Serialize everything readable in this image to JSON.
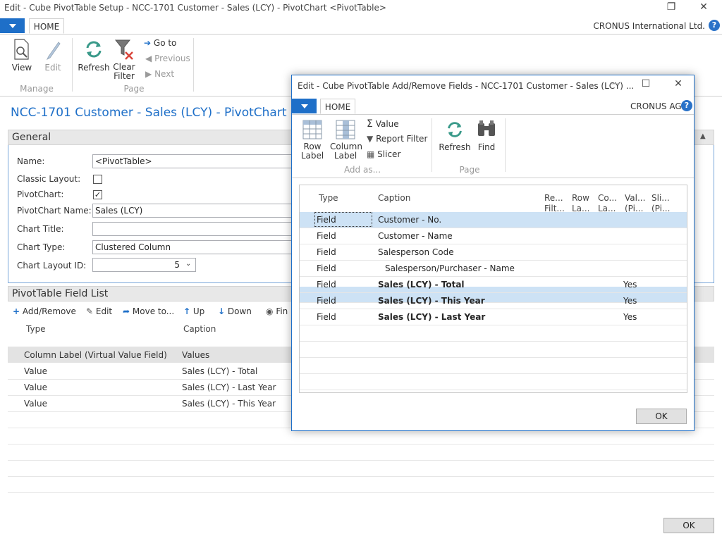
{
  "window": {
    "title": "Edit - Cube PivotTable Setup - NCC-1701 Customer - Sales (LCY) - PivotChart <PivotTable>",
    "company": "CRONUS International Ltd."
  },
  "ribbon": {
    "tab": "HOME",
    "view": "View",
    "edit": "Edit",
    "manage_group": "Manage",
    "refresh": "Refresh",
    "clear": "Clear",
    "filter": "Filter",
    "go_to": "Go to",
    "previous": "Previous",
    "next": "Next",
    "page_group": "Page"
  },
  "page": {
    "title": "NCC-1701 Customer - Sales (LCY) - PivotChart <Piv"
  },
  "general": {
    "header": "General",
    "name_label": "Name:",
    "name_value": "<PivotTable>",
    "classic_layout_label": "Classic Layout:",
    "pivotchart_label": "PivotChart:",
    "pivotchart_name_label": "PivotChart Name:",
    "pivotchart_name_value": "Sales (LCY)",
    "chart_title_label": "Chart Title:",
    "chart_title_value": "",
    "chart_type_label": "Chart Type:",
    "chart_type_value": "Clustered Column",
    "chart_layout_label": "Chart Layout ID:",
    "chart_layout_value": "5"
  },
  "field_list": {
    "header": "PivotTable Field List",
    "actions": {
      "add_remove": "Add/Remove",
      "edit": "Edit",
      "move_to": "Move to...",
      "up": "Up",
      "down": "Down",
      "find": "Fin"
    },
    "columns": [
      "Type",
      "Caption"
    ],
    "rows": [
      {
        "type": "Column Label (Virtual Value Field)",
        "caption": "Values"
      },
      {
        "type": "Value",
        "caption": "Sales (LCY) - Total"
      },
      {
        "type": "Value",
        "caption": "Sales (LCY) - Last Year"
      },
      {
        "type": "Value",
        "caption": "Sales (LCY) - This Year"
      }
    ]
  },
  "ok_label": "OK",
  "modal": {
    "title": "Edit - Cube PivotTable Add/Remove Fields - NCC-1701 Customer - Sales (LCY) ...",
    "company": "CRONUS AG",
    "tab": "HOME",
    "row_label_1": "Row",
    "row_label_2": "Label",
    "column_label_1": "Column",
    "column_label_2": "Label",
    "value": "Value",
    "report_filter": "Report Filter",
    "slicer": "Slicer",
    "add_as_group": "Add as...",
    "refresh": "Refresh",
    "find": "Find",
    "page_group": "Page",
    "columns": {
      "type": "Type",
      "caption": "Caption",
      "re_1": "Re...",
      "re_2": "Filt...",
      "row_1": "Row",
      "row_2": "La...",
      "co_1": "Co...",
      "co_2": "La...",
      "val_1": "Val...",
      "val_2": "(Pi...",
      "sli_1": "Sli...",
      "sli_2": "(Pi..."
    },
    "rows": [
      {
        "type": "Field",
        "caption": "Customer - No.",
        "value": ""
      },
      {
        "type": "Field",
        "caption": "Customer - Name",
        "value": ""
      },
      {
        "type": "Field",
        "caption": "Salesperson Code",
        "value": ""
      },
      {
        "type": "Field",
        "caption": "Salesperson/Purchaser - Name",
        "value": ""
      },
      {
        "type": "Field",
        "caption": "Sales (LCY) - Total",
        "value": "Yes"
      },
      {
        "type": "Field",
        "caption": "Sales (LCY) - This Year",
        "value": "Yes"
      },
      {
        "type": "Field",
        "caption": "Sales (LCY) - Last Year",
        "value": "Yes"
      }
    ],
    "ok_label": "OK"
  },
  "colors": {
    "accent": "#1e6fc8",
    "selection": "#cde2f5"
  }
}
